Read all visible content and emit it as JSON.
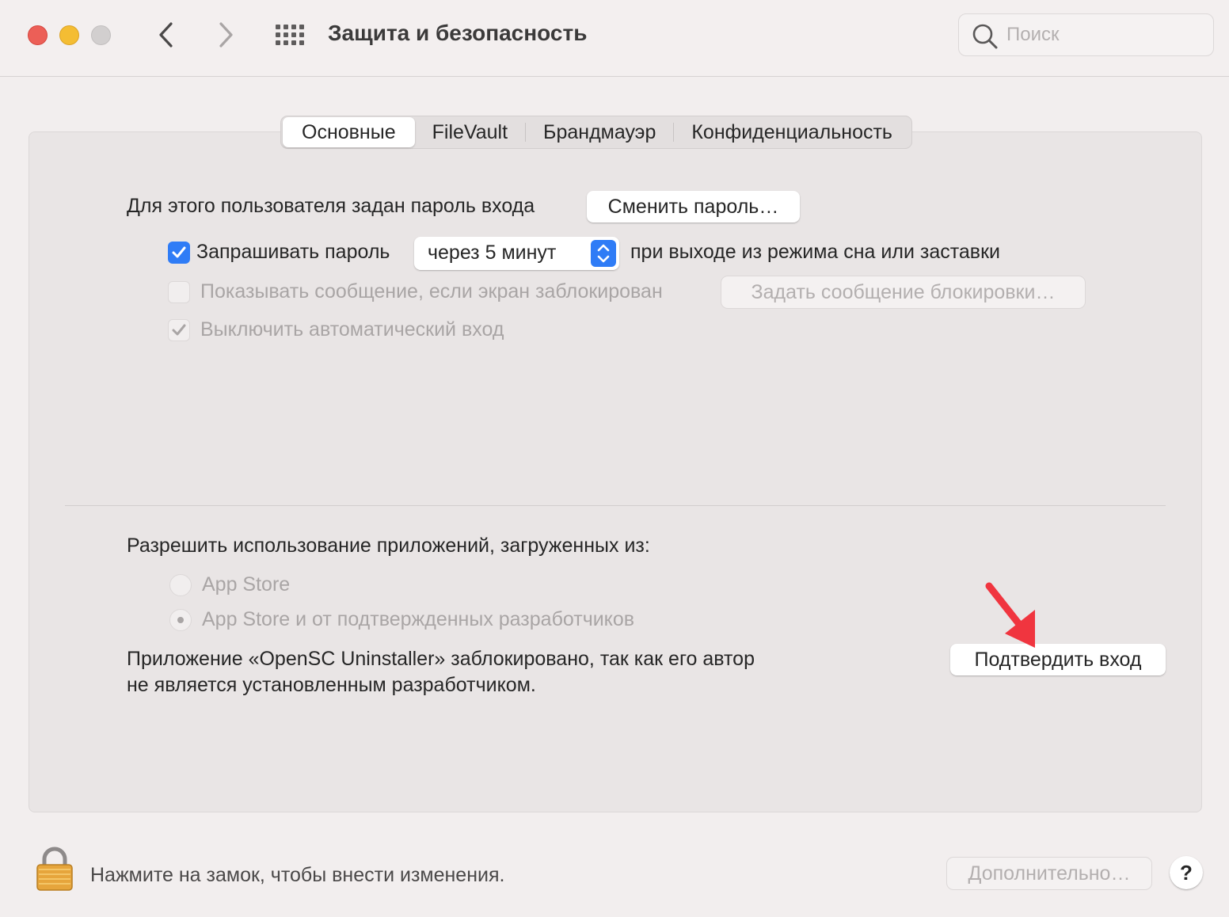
{
  "window": {
    "title": "Защита и безопасность",
    "search_placeholder": "Поиск"
  },
  "tabs": [
    {
      "label": "Основные",
      "active": true
    },
    {
      "label": "FileVault",
      "active": false
    },
    {
      "label": "Брандмауэр",
      "active": false
    },
    {
      "label": "Конфиденциальность",
      "active": false
    }
  ],
  "general": {
    "password_set_text": "Для этого пользователя задан пароль входа",
    "change_password_button": "Сменить пароль…",
    "require_password": {
      "label": "Запрашивать пароль",
      "checked": true
    },
    "delay_popup_value": "через 5 минут",
    "after_sleep_text": "при выходе из режима сна или заставки",
    "show_message": {
      "label": "Показывать сообщение, если экран заблокирован",
      "checked": false,
      "enabled": false
    },
    "set_lock_message_button": "Задать сообщение блокировки…",
    "disable_auto_login": {
      "label": "Выключить автоматический вход",
      "checked": true,
      "enabled": false
    }
  },
  "apps": {
    "heading": "Разрешить использование приложений, загруженных из:",
    "options": [
      {
        "label": "App Store",
        "selected": false
      },
      {
        "label": "App Store и от подтвержденных разработчиков",
        "selected": true
      }
    ],
    "blocked_line1": "Приложение «OpenSC Uninstaller» заблокировано, так как его автор",
    "blocked_line2": "не является установленным разработчиком.",
    "confirm_button": "Подтвердить вход"
  },
  "footer": {
    "lock_text": "Нажмите на замок, чтобы внести изменения.",
    "advanced_button": "Дополнительно…",
    "help_label": "?"
  },
  "colors": {
    "accent": "#2f7cf6",
    "annotation_arrow": "#f0353f"
  },
  "icons": [
    "close-icon",
    "minimize-icon",
    "zoom-icon",
    "chevron-left-icon",
    "chevron-right-icon",
    "grid-icon",
    "search-icon",
    "checkmark-icon",
    "stepper-icon",
    "lock-icon",
    "annotation-arrow-icon"
  ]
}
